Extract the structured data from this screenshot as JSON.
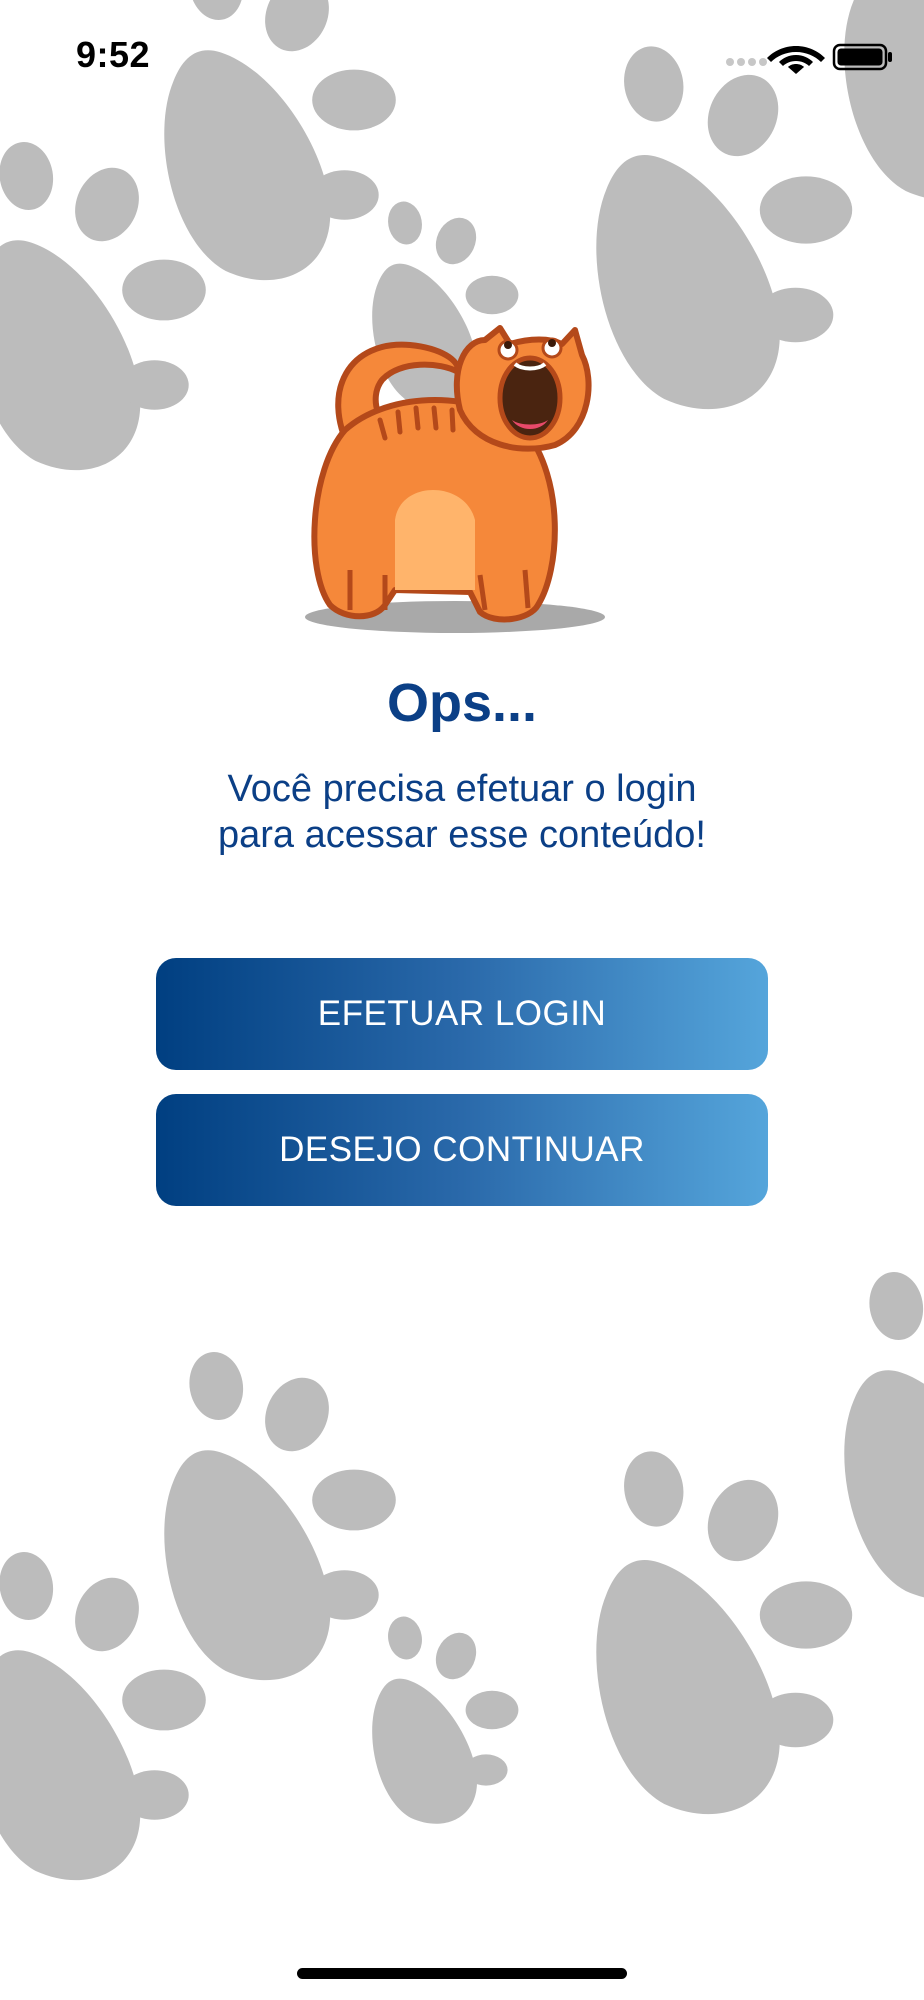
{
  "status_bar": {
    "time": "9:52",
    "icons": [
      "signal-icon",
      "wifi-icon",
      "battery-icon"
    ]
  },
  "illustration": {
    "name": "yelling-orange-cat",
    "colors": {
      "fur": "#f5883a",
      "belly": "#ffb46b",
      "outline": "#b4491a",
      "mouth": "#4a2410"
    }
  },
  "background": {
    "pattern": "paw-prints",
    "paw_color": "#bcbcbc"
  },
  "content": {
    "title": "Ops...",
    "message_line1": "Você precisa efetuar o login",
    "message_line2": "para acessar esse conteúdo!"
  },
  "buttons": {
    "login_label": "EFETUAR LOGIN",
    "continue_label": "DESEJO CONTINUAR"
  },
  "colors": {
    "primary_text": "#0b3f86",
    "button_gradient_start": "#003f81",
    "button_gradient_end": "#55a5db"
  }
}
